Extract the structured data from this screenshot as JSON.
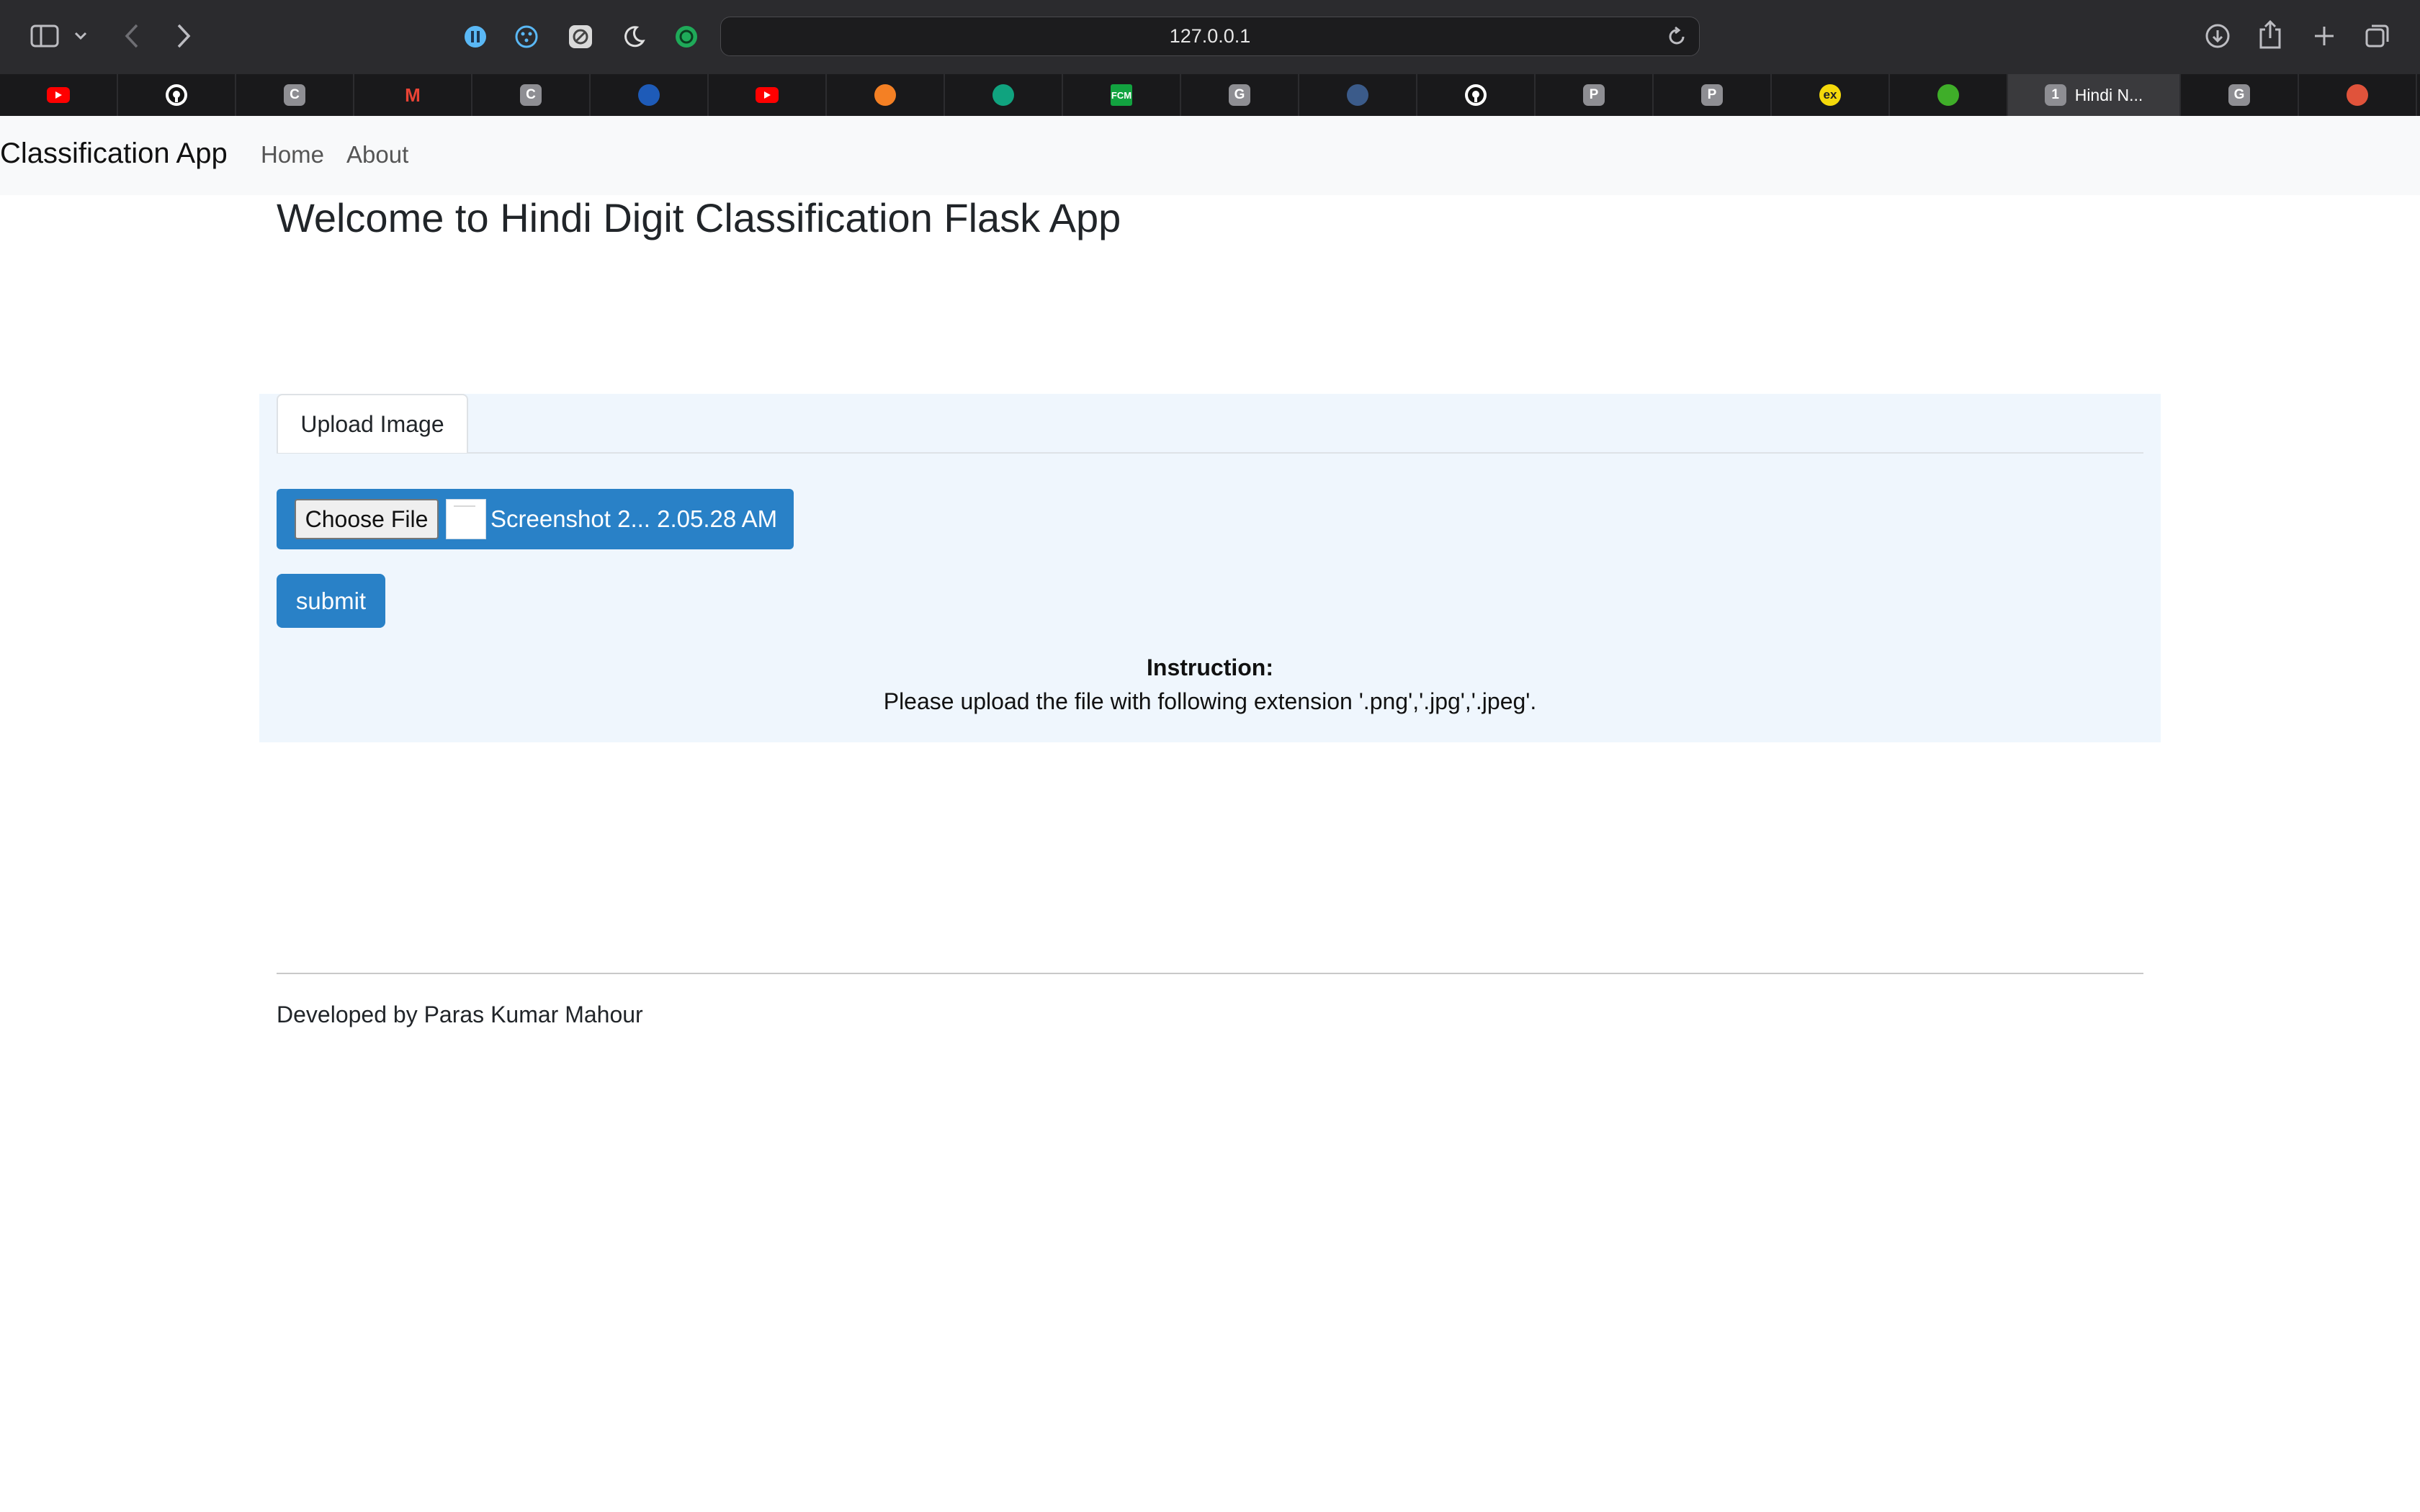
{
  "browser": {
    "url": "127.0.0.1",
    "tabs": [
      {
        "icon": "youtube-icon",
        "letter": "",
        "color": "#ff0000"
      },
      {
        "icon": "github-icon",
        "letter": "",
        "color": "#ffffff"
      },
      {
        "icon": "letter-favicon",
        "letter": "C",
        "color": "#8e8e93"
      },
      {
        "icon": "gmail-icon",
        "letter": "M",
        "color": "#ea4335"
      },
      {
        "icon": "letter-favicon",
        "letter": "C",
        "color": "#8e8e93"
      },
      {
        "icon": "blue-circle-favicon",
        "letter": "",
        "color": "#1e5bb8"
      },
      {
        "icon": "youtube-icon",
        "letter": "",
        "color": "#ff0000"
      },
      {
        "icon": "stackoverflow-icon",
        "letter": "",
        "color": "#f48024"
      },
      {
        "icon": "chatgpt-icon",
        "letter": "",
        "color": "#10a37f"
      },
      {
        "icon": "fcm-favicon",
        "letter": "FCM",
        "color": "#12a340"
      },
      {
        "icon": "letter-favicon",
        "letter": "G",
        "color": "#8e8e93"
      },
      {
        "icon": "terminal-favicon",
        "letter": "",
        "color": "#3b5b8a"
      },
      {
        "icon": "github-icon",
        "letter": "",
        "color": "#ffffff"
      },
      {
        "icon": "letter-favicon",
        "letter": "P",
        "color": "#8e8e93"
      },
      {
        "icon": "letter-favicon",
        "letter": "P",
        "color": "#8e8e93"
      },
      {
        "icon": "ex-favicon",
        "letter": "ex",
        "color": "#f5d90a"
      },
      {
        "icon": "green-favicon",
        "letter": "",
        "color": "#3fae29"
      },
      {
        "icon": "letter-favicon",
        "letter": "1",
        "color": "#8e8e93",
        "title": "Hindi N...",
        "active": true
      },
      {
        "icon": "letter-favicon",
        "letter": "G",
        "color": "#8e8e93"
      },
      {
        "icon": "colorful-favicon",
        "letter": "",
        "color": "#e0533b"
      }
    ]
  },
  "navbar": {
    "brand": "Classification App",
    "links": [
      "Home",
      "About"
    ]
  },
  "main": {
    "title": "Welcome to Hindi Digit Classification Flask App",
    "tab_label": "Upload Image",
    "choose_file_label": "Choose File",
    "file_name": "Screenshot 2... 2.05.28 AM",
    "submit_label": "submit",
    "instruction_title": "Instruction:",
    "instruction_text": "Please upload the file with following extension '.png','.jpg','.jpeg'."
  },
  "footer": {
    "text": "Developed by Paras Kumar Mahour"
  },
  "colors": {
    "primary": "#2981c7",
    "panel_bg": "#eff6fd",
    "navbar_bg": "#f8f9fa"
  }
}
